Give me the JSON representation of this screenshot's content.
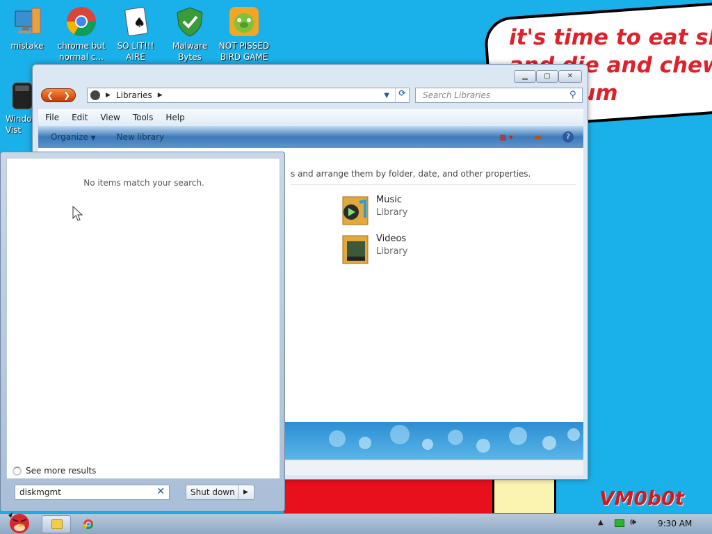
{
  "desktop": {
    "icons": [
      {
        "label": "mistake",
        "icon": "computer-icon"
      },
      {
        "label": "chrome but normal c...",
        "icon": "chrome-icon"
      },
      {
        "label": "SO LIT!!! AIRE",
        "icon": "solitaire-icon"
      },
      {
        "label": "Malware Bytes",
        "icon": "shield-icon"
      },
      {
        "label": "NOT PISSED BIRD GAME",
        "icon": "pig-icon"
      },
      {
        "label": "Windo Vist",
        "icon": "trash-icon"
      }
    ],
    "bubble_text": [
      "it's time to eat shit",
      "and die and chew",
      "gum"
    ],
    "signature": "VM0b0t"
  },
  "explorer": {
    "breadcrumb": "Libraries",
    "search_placeholder": "Search Libraries",
    "menu": [
      "File",
      "Edit",
      "View",
      "Tools",
      "Help"
    ],
    "commands": {
      "organize": "Organize",
      "new_library": "New library"
    },
    "description": "s and arrange them by folder, date, and other properties.",
    "libraries": [
      {
        "name": "Music",
        "type": "Library"
      },
      {
        "name": "Videos",
        "type": "Library"
      }
    ]
  },
  "start_menu": {
    "no_results": "No items match your search.",
    "see_more": "See more results",
    "search_value": "diskmgmt",
    "shutdown_label": "Shut down"
  },
  "taskbar": {
    "clock": "9:30 AM"
  },
  "colors": {
    "desktop_bg": "#1ab0ea",
    "bubble_text": "#e0202a",
    "accent": "#3d7ab8"
  }
}
